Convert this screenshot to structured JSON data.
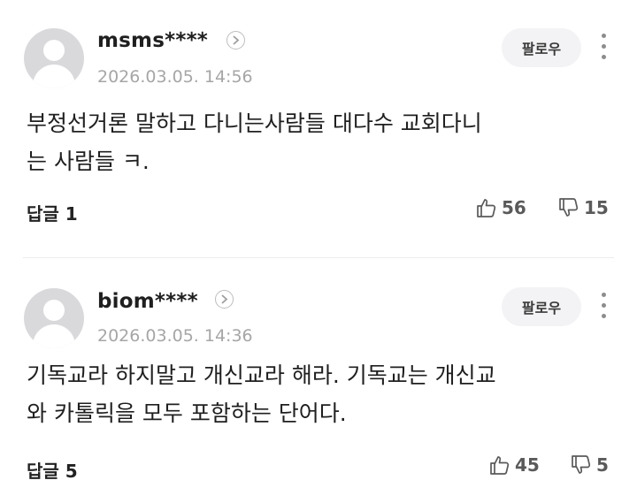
{
  "comments": [
    {
      "username": "msms****",
      "timestamp": "2026.03.05. 14:56",
      "follow_label": "팔로우",
      "text_lines": [
        "부정선거론 말하고 다니는사람들 대다수 교회다니",
        "는 사람들 ㅋ."
      ],
      "replies_label": "답글 1",
      "likes": "56",
      "dislikes": "15"
    },
    {
      "username": "biom****",
      "timestamp": "2026.03.05. 14:36",
      "follow_label": "팔로우",
      "text_lines": [
        "기독교라 하지말고 개신교라 해라. 기독교는 개신교",
        "와 카톨릭을 모두 포함하는 단어다."
      ],
      "replies_label": "답글 5",
      "likes": "45",
      "dislikes": "5"
    }
  ],
  "icons": {
    "avatar": "default-user-avatar",
    "profile_link": "chevron-right-icon",
    "more": "more-vertical-icon",
    "like": "thumbs-up-icon",
    "dislike": "thumbs-down-icon"
  },
  "colors": {
    "text": "#1f1f1f",
    "timestamp": "#a6a6a6",
    "follow_bg": "#f3f3f5",
    "avatar_bg": "#d9d9dc"
  }
}
